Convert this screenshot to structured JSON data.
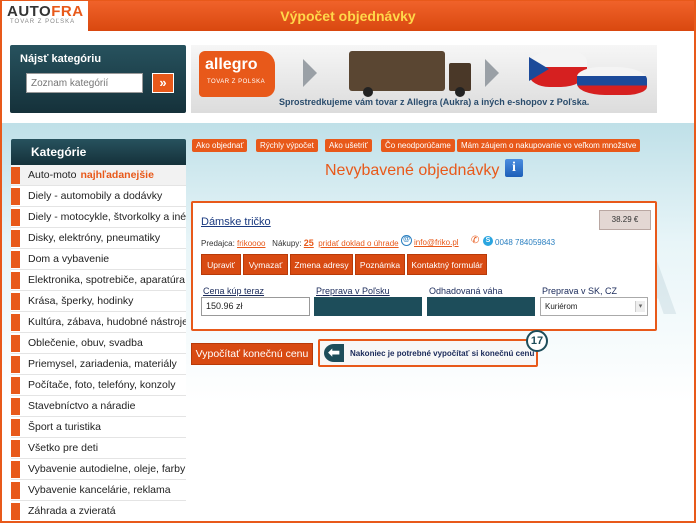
{
  "header": {
    "logo_main": "AUTO",
    "logo_accent": "FRA",
    "logo_sub": "TOVAR Z POĽSKA",
    "title": "Výpočet objednávky"
  },
  "search": {
    "label": "Nájsť kategóriu",
    "placeholder": "Zoznam kategórií",
    "button_icon": "»"
  },
  "banner": {
    "brand": "allegro",
    "brand_sub": "TOVAR Z POLSKA",
    "text": "Sprostredkujeme vám tovar z Allegra (Aukra) a iných e-shopov z Poľska."
  },
  "sidebar": {
    "heading": "Kategórie",
    "items": [
      {
        "label": "Auto-moto",
        "hot": "najhľadanejšie"
      },
      {
        "label": "Diely - automobily a dodávky"
      },
      {
        "label": "Diely - motocykle, štvorkolky a iné"
      },
      {
        "label": "Disky, elektróny, pneumatiky"
      },
      {
        "label": "Dom a vybavenie"
      },
      {
        "label": "Elektronika, spotrebiče, aparatúra"
      },
      {
        "label": "Krása, šperky, hodinky"
      },
      {
        "label": "Kultúra, zábava, hudobné nástroje"
      },
      {
        "label": "Oblečenie, obuv, svadba"
      },
      {
        "label": "Priemysel, zariadenia, materiály"
      },
      {
        "label": "Počítače, foto, telefóny, konzoly"
      },
      {
        "label": "Stavebníctvo a náradie"
      },
      {
        "label": "Šport a turistika"
      },
      {
        "label": "Všetko pre deti"
      },
      {
        "label": "Vybavenie autodielne, oleje, farby"
      },
      {
        "label": "Vybavenie kancelárie, reklama"
      },
      {
        "label": "Záhrada a zvieratá"
      }
    ]
  },
  "tabs": [
    "Ako objednať",
    "Rýchly výpočet",
    "Ako ušetriť",
    "Čo neodporúčame",
    "Mám záujem o nakupovanie vo veľkom množstve"
  ],
  "main": {
    "title": "Nevybavené objednávky",
    "info_icon": "i"
  },
  "order": {
    "product": "Dámske tričko",
    "price": "38.29 €",
    "seller_label": "Predajca:",
    "seller": "frikoooo",
    "purchases_label": "Nákupy:",
    "purchases": "25",
    "proof": "pridať doklad o úhrade",
    "email": "info@friko.pl",
    "phone": "0048 784059843",
    "actions": [
      "Upraviť",
      "Vymazať",
      "Zmena adresy",
      "Poznámka",
      "Kontaktný formulár"
    ],
    "fields": {
      "price_label": "Cena kúp teraz",
      "price_value": "150.96 zł",
      "shipping_pl_label": "Preprava v Poľsku",
      "weight_label": "Odhadovaná váha",
      "shipping_sk_label": "Preprava v SK, CZ",
      "shipping_sk_value": "Kuriérom"
    }
  },
  "bottom": {
    "calc_button": "Vypočítať konečnú cenu",
    "hint": "Nakoniec je potrebné vypočítať si konečnú cenu",
    "step": "17"
  }
}
